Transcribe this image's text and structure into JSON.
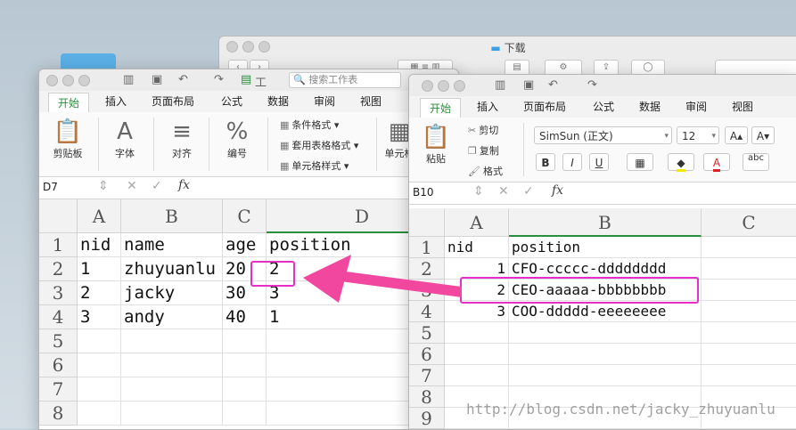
{
  "finder": {
    "title": "下载"
  },
  "win1": {
    "search_placeholder": "搜索工作表",
    "toolbar_letter": "工",
    "tabs": [
      "开始",
      "插入",
      "页面布局",
      "公式",
      "数据",
      "审阅",
      "视图"
    ],
    "ribbon": {
      "paste": "剪贴板",
      "font": "字体",
      "align": "对齐",
      "number": "编号",
      "cond_format": "条件格式",
      "table_format": "套用表格格式",
      "cell_style": "单元格样式",
      "cells": "单元格",
      "percent_glyph": "%"
    },
    "namebox": "D7",
    "columns": [
      "A",
      "B",
      "C",
      "D"
    ],
    "rows": [
      "1",
      "2",
      "3",
      "4",
      "5",
      "6",
      "7",
      "8"
    ],
    "data": [
      [
        "nid",
        "name",
        "age",
        "position"
      ],
      [
        "1",
        "zhuyuanlu",
        "20",
        "2"
      ],
      [
        "2",
        "jacky",
        "30",
        "3"
      ],
      [
        "3",
        "andy",
        "40",
        "1"
      ]
    ]
  },
  "win2": {
    "tabs": [
      "开始",
      "插入",
      "页面布局",
      "公式",
      "数据",
      "审阅",
      "视图"
    ],
    "ribbon": {
      "paste": "粘贴",
      "cut": "剪切",
      "copy": "复制",
      "format": "格式",
      "font_name": "SimSun (正文)",
      "font_size": "12",
      "bold": "B",
      "italic": "I",
      "underline": "U",
      "grow": "A",
      "shrink": "A",
      "abc": "abc"
    },
    "namebox": "B10",
    "columns": [
      "A",
      "B",
      "C"
    ],
    "rows": [
      "1",
      "2",
      "3",
      "4",
      "5",
      "6",
      "7",
      "8",
      "9"
    ],
    "data": [
      [
        "nid",
        "position"
      ],
      [
        "1",
        "CFO-ccccc-dddddddd"
      ],
      [
        "2",
        "CEO-aaaaa-bbbbbbbb"
      ],
      [
        "3",
        "COO-ddddd-eeeeeeee"
      ]
    ]
  },
  "watermark": "http://blog.csdn.net/jacky_zhuyuanlu",
  "colors": {
    "accent_green": "#2a8f3c",
    "highlight_magenta": "#e62fc6",
    "arrow_pink": "#f2479f"
  }
}
